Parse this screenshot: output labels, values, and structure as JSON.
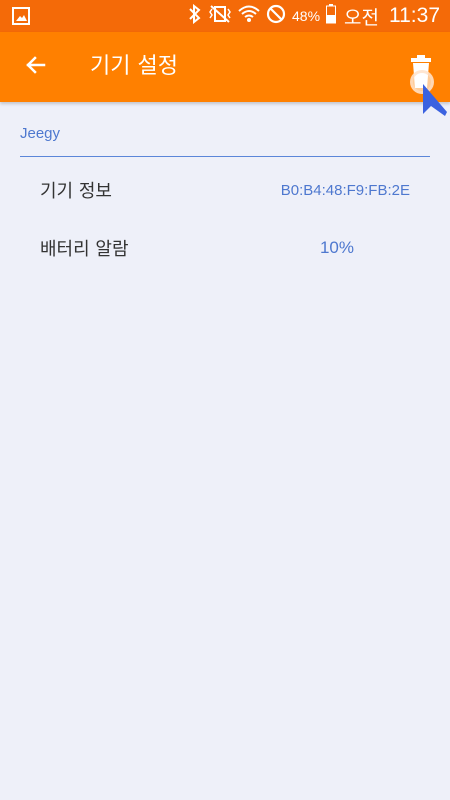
{
  "status_bar": {
    "battery_pct": "48%",
    "ampm": "오전",
    "time": "11:37",
    "icons": [
      "image-icon",
      "bluetooth-icon",
      "vibrate-icon",
      "wifi-icon",
      "do-not-disturb-icon",
      "battery-icon"
    ]
  },
  "app_bar": {
    "back_icon": "arrow-left-icon",
    "title": "기기 설정",
    "delete_icon": "trash-icon"
  },
  "device": {
    "name": "Jeegy",
    "rows": [
      {
        "label": "기기 정보",
        "value": "B0:B4:48:F9:FB:2E"
      },
      {
        "label": "배터리 알람",
        "value": "10%"
      }
    ]
  },
  "colors": {
    "status_bar": "#f46a08",
    "app_bar": "#ff8000",
    "background": "#eef0f9",
    "accent": "#4e78cf"
  }
}
